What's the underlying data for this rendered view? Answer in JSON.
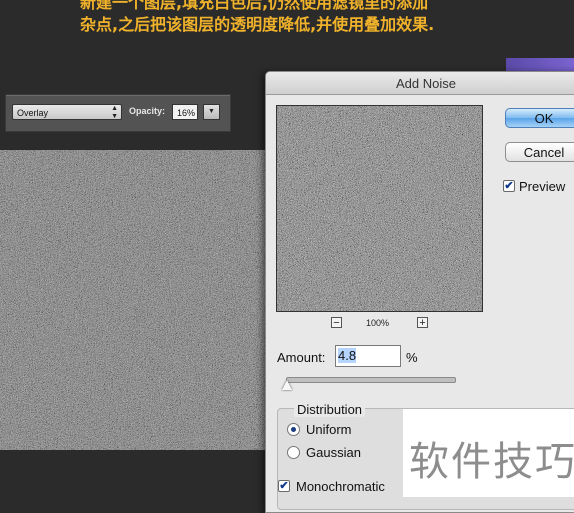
{
  "caption": {
    "line1": "新建一个图层,填充白色后,仍然使用滤镜里的添加",
    "line2": "杂点,之后把该图层的透明度降低,并使用叠加效果."
  },
  "layers_panel": {
    "blend_mode": "Overlay",
    "opacity_label": "Opacity:",
    "opacity_value": "16%"
  },
  "dialog": {
    "title": "Add Noise",
    "ok_label": "OK",
    "cancel_label": "Cancel",
    "preview_label": "Preview",
    "preview_checked": true,
    "zoom_minus": "−",
    "zoom_plus": "+",
    "zoom_level": "100%",
    "amount_label": "Amount:",
    "amount_value": "4.8",
    "amount_unit": "%",
    "distribution_label": "Distribution",
    "distribution_options": [
      "Uniform",
      "Gaussian"
    ],
    "distribution_selected": "Uniform",
    "monochromatic_label": "Monochromatic",
    "monochromatic_checked": true
  },
  "watermark": {
    "text": "软件技巧"
  },
  "colors": {
    "caption": "#f0b22a",
    "ok_button": "#5aa4ea",
    "dialog_bg": "#e8e8e8"
  }
}
